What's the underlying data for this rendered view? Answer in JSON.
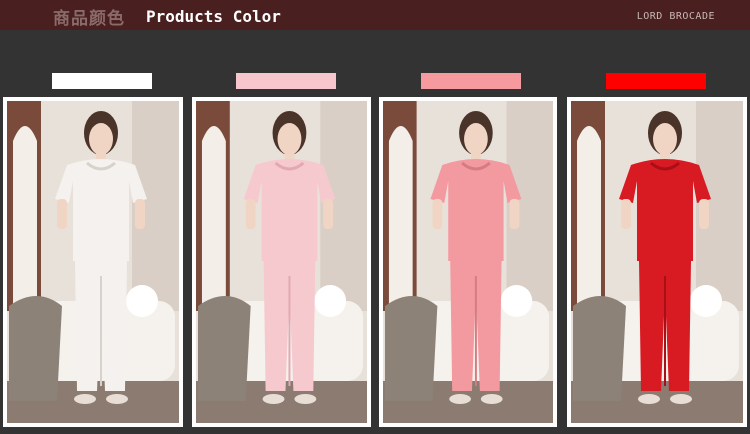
{
  "header": {
    "title_cn": "商品颜色",
    "title_en": "Products Color",
    "brand": "LORD BROCADE"
  },
  "colors": {
    "header_bg": "#4a1f1f",
    "page_bg": "#333333"
  },
  "variants": [
    {
      "swatch": "#ffffff",
      "garment": "#f4f1ee",
      "shade": "#d8d2cc",
      "image": "model-white-pajamas"
    },
    {
      "swatch": "#f7c6cc",
      "garment": "#f6c9cf",
      "shade": "#e3a9b1",
      "image": "model-light-pink-pajamas"
    },
    {
      "swatch": "#f59a9e",
      "garment": "#f29aa0",
      "shade": "#d77b82",
      "image": "model-pink-pajamas"
    },
    {
      "swatch": "#ff0000",
      "garment": "#d81a22",
      "shade": "#a80f16",
      "image": "model-red-pajamas"
    }
  ]
}
